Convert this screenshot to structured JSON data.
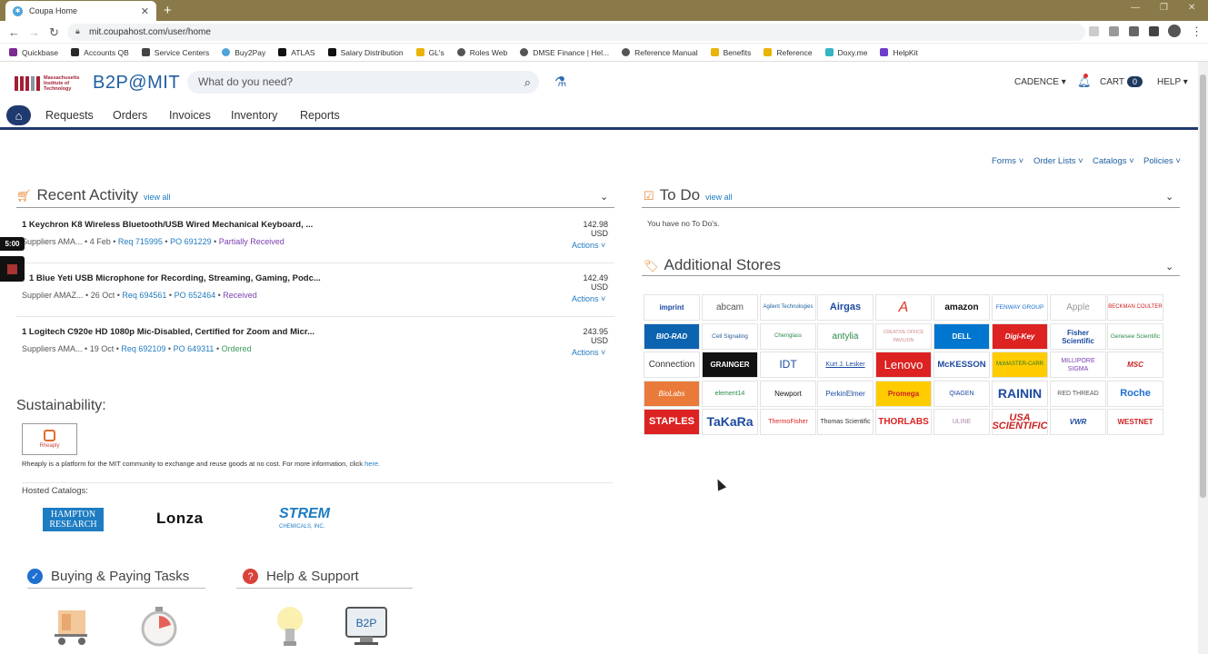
{
  "browser": {
    "tab_title": "Coupa Home",
    "url": "mit.coupahost.com/user/home",
    "bookmarks": [
      "Quickbase",
      "Accounts QB",
      "Service Centers",
      "Buy2Pay",
      "ATLAS",
      "Salary Distribution",
      "GL's",
      "Roles Web",
      "DMSE Finance | Hel...",
      "Reference Manual",
      "Benefits",
      "Reference",
      "Doxy.me",
      "HelpKit"
    ]
  },
  "header": {
    "logo_text": "Massachusetts Institute of Technology",
    "app_name": "B2P@MIT",
    "search_placeholder": "What do you need?",
    "user": "CADENCE",
    "cart_label": "CART",
    "cart_count": "0",
    "help_label": "HELP"
  },
  "nav": {
    "items": [
      "Requests",
      "Orders",
      "Invoices",
      "Inventory",
      "Reports"
    ]
  },
  "utility_links": [
    "Forms",
    "Order Lists",
    "Catalogs",
    "Policies"
  ],
  "recent_activity": {
    "title": "Recent Activity",
    "view_all": "view all",
    "items": [
      {
        "title": "1 Keychron K8 Wireless Bluetooth/USB Wired Mechanical Keyboard, ...",
        "supplier": "Suppliers AMA...",
        "date": "4 Feb",
        "req": "Req 715995",
        "po": "PO 691229",
        "status": "Partially Received",
        "price": "142.98 USD",
        "actions": "Actions"
      },
      {
        "title": "1 Blue Yeti USB Microphone for Recording, Streaming, Gaming, Podc...",
        "supplier": "Supplier AMAZ...",
        "date": "26 Oct",
        "req": "Req 694561",
        "po": "PO 652464",
        "status": "Received",
        "price": "142.49 USD",
        "actions": "Actions"
      },
      {
        "title": "1 Logitech C920e HD 1080p Mic-Disabled, Certified for Zoom and Micr...",
        "supplier": "Suppliers AMA...",
        "date": "19 Oct",
        "req": "Req 692109",
        "po": "PO 649311",
        "status": "Ordered",
        "price": "243.95 USD",
        "actions": "Actions"
      }
    ]
  },
  "recorder": {
    "timer": "5:00"
  },
  "sustainability": {
    "title": "Sustainability:",
    "logo_text": "Rheaply",
    "description": "Rheaply is a platform for the MIT community to exchange and reuse goods at no cost. For more information, click",
    "link": "here."
  },
  "hosted_catalogs": {
    "label": "Hosted Catalogs:",
    "logos": [
      "HAMPTON RESEARCH",
      "Lonza",
      "STREM",
      "CHEMICALS, INC."
    ]
  },
  "tasks": {
    "buying": "Buying & Paying Tasks",
    "help": "Help & Support",
    "tile_b2p": "B2P"
  },
  "todo": {
    "title": "To Do",
    "view_all": "view all",
    "empty_text": "You have no To Do's."
  },
  "stores": {
    "title": "Additional Stores",
    "rows": [
      [
        "imprint",
        "abcam",
        "Agilent Technologies",
        "Airgas",
        "A",
        "amazon",
        "FENWAY GROUP",
        "Apple",
        "BECKMAN COULTER"
      ],
      [
        "BIO-RAD",
        "Cell Signaling",
        "Chemglass",
        "antylia",
        "CREATIVE OFFICE PAVILION",
        "DELL",
        "Digi-Key",
        "Fisher Scientific",
        "Genesee Scientific"
      ],
      [
        "Connection",
        "GRAINGER",
        "IDT",
        "Kurt J. Lesker",
        "Lenovo",
        "McKESSON",
        "McMASTER-CARR",
        "MILLIPORE SIGMA",
        "MSC"
      ],
      [
        "BioLabs",
        "element14",
        "Newport",
        "PerkinElmer",
        "Promega",
        "QIAGEN",
        "RAININ",
        "RED THREAD",
        "Roche"
      ],
      [
        "STAPLES",
        "TaKaRa",
        "ThermoFisher",
        "Thomas Scientific",
        "THORLABS",
        "ULINE",
        "USA SCIENTIFIC",
        "VWR",
        "WESTNET"
      ]
    ]
  }
}
